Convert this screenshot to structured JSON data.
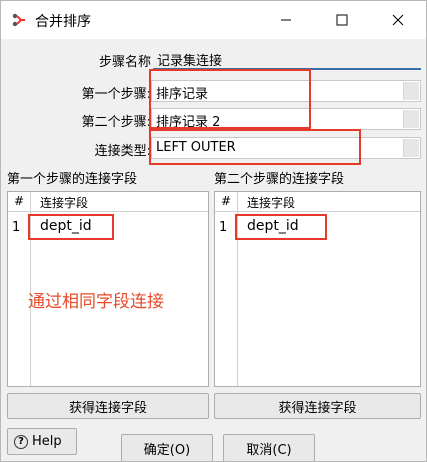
{
  "window": {
    "title": "合并排序",
    "icon": "merge-join-icon"
  },
  "form": {
    "step_name_label": "步骤名称",
    "step_name_value": "记录集连接",
    "first_step_label": "第一个步骤:",
    "first_step_value": "排序记录",
    "second_step_label": "第二个步骤:",
    "second_step_value": "排序记录 2",
    "join_type_label": "连接类型:",
    "join_type_value": "LEFT OUTER"
  },
  "left_panel": {
    "title": "第一个步骤的连接字段",
    "col_num": "#",
    "col_field": "连接字段",
    "rows": [
      {
        "num": "1",
        "field": "dept_id"
      }
    ],
    "button": "获得连接字段"
  },
  "right_panel": {
    "title": "第二个步骤的连接字段",
    "col_num": "#",
    "col_field": "连接字段",
    "rows": [
      {
        "num": "1",
        "field": "dept_id"
      }
    ],
    "button": "获得连接字段"
  },
  "annotation": "通过相同字段连接",
  "footer": {
    "help": "Help",
    "ok": "确定(O)",
    "cancel": "取消(C)"
  },
  "colors": {
    "highlight": "#e53a2a",
    "annotation": "#e84a2a",
    "accent": "#3a6ea5"
  }
}
